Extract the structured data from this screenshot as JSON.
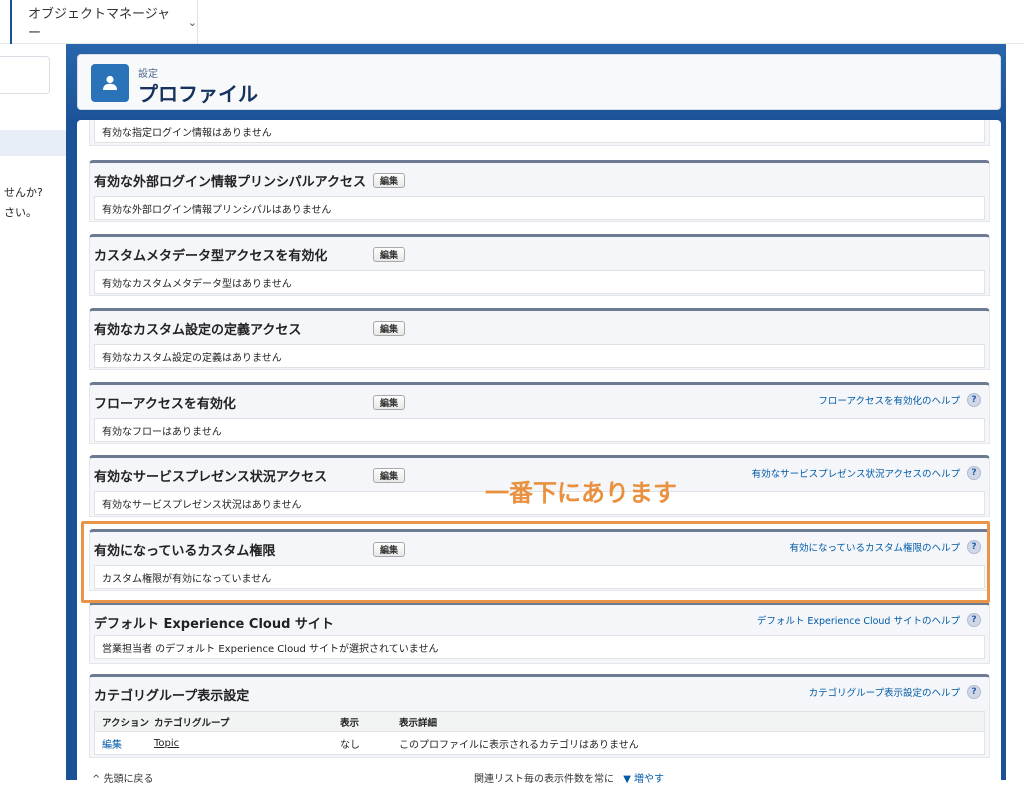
{
  "topbar": {
    "object_manager_label": "オブジェクトマネージャー"
  },
  "sidebar": {
    "line1": "せんか?",
    "line2": "さい。"
  },
  "header": {
    "breadcrumb": "設定",
    "title": "プロファイル"
  },
  "sections": {
    "login_ip": {
      "body": "有効な指定ログイン情報はありません"
    },
    "external_principal": {
      "title": "有効な外部ログイン情報プリンシパルアクセス",
      "edit": "編集",
      "body": "有効な外部ログイン情報プリンシパルはありません"
    },
    "custom_metadata": {
      "title": "カスタムメタデータ型アクセスを有効化",
      "edit": "編集",
      "body": "有効なカスタムメタデータ型はありません"
    },
    "custom_settings": {
      "title": "有効なカスタム設定の定義アクセス",
      "edit": "編集",
      "body": "有効なカスタム設定の定義はありません"
    },
    "flow_access": {
      "title": "フローアクセスを有効化",
      "edit": "編集",
      "help": "フローアクセスを有効化のヘルプ",
      "body": "有効なフローはありません"
    },
    "service_presence": {
      "title": "有効なサービスプレゼンス状況アクセス",
      "edit": "編集",
      "help": "有効なサービスプレゼンス状況アクセスのヘルプ",
      "body": "有効なサービスプレゼンス状況はありません"
    },
    "custom_permissions": {
      "title": "有効になっているカスタム権限",
      "edit": "編集",
      "help": "有効になっているカスタム権限のヘルプ",
      "body": "カスタム権限が有効になっていません"
    },
    "experience_cloud": {
      "title": "デフォルト Experience Cloud サイト",
      "help": "デフォルト Experience Cloud サイトのヘルプ",
      "body": "営業担当者 のデフォルト Experience Cloud サイトが選択されていません"
    },
    "category_group": {
      "title": "カテゴリグループ表示設定",
      "help": "カテゴリグループ表示設定のヘルプ",
      "columns": [
        "アクション",
        "カテゴリグループ",
        "表示",
        "表示詳細"
      ],
      "rows": [
        {
          "action": "編集",
          "group": "Topic",
          "visibility": "なし",
          "detail": "このプロファイルに表示されるカテゴリはありません"
        }
      ]
    }
  },
  "help_icon_glyph": "?",
  "annotation": {
    "text": "一番下にあります",
    "color": "#e9913f"
  },
  "footer": {
    "back_to_top": "^ 先頭に戻る",
    "list_display": "関連リスト毎の表示件数を常に",
    "increase": "▼ 増やす"
  },
  "colors": {
    "brand_blue": "#1b5297",
    "link": "#015ba7",
    "highlight": "#e8954a"
  }
}
